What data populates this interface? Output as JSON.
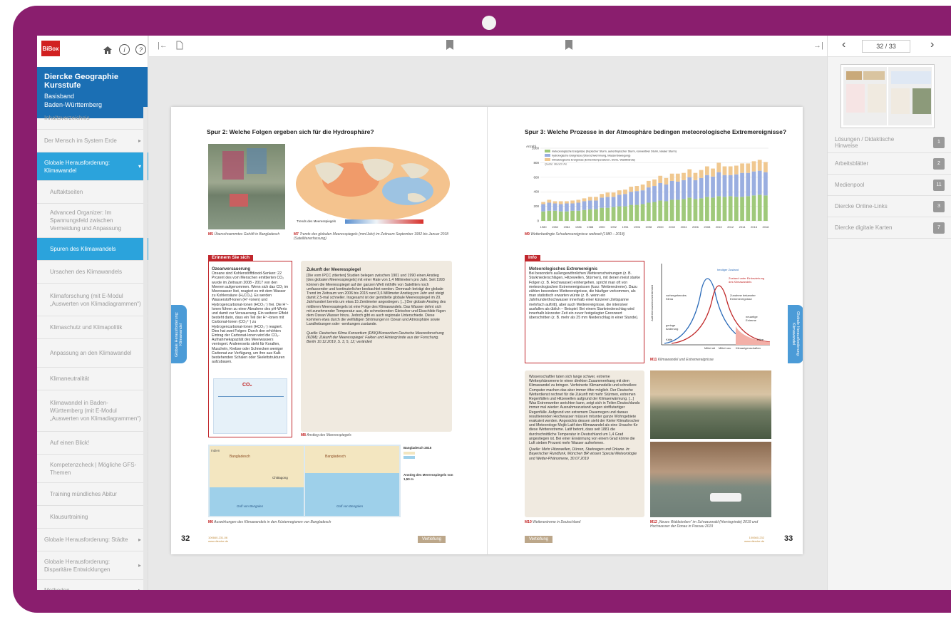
{
  "app": {
    "logo": "BiBox"
  },
  "book": {
    "title": "Diercke Geographie Kursstufe",
    "line2": "Basisband",
    "line3": "Baden-Württemberg"
  },
  "nav": [
    {
      "label": "Inhaltsverzeichnis",
      "level": 0,
      "h": 32
    },
    {
      "label": "Der Mensch im System Erde",
      "level": 0,
      "h": 32,
      "caret": "▸"
    },
    {
      "label": "Globale Herausforderung: Klimawandel",
      "level": 0,
      "h": 40,
      "caret": "▾",
      "active": true
    },
    {
      "label": "Auftaktseiten",
      "level": 1,
      "h": 32
    },
    {
      "label": "Advanced Organizer: Im Spannungsfeld zwischen Vermeidung und Anpassung",
      "level": 1,
      "h": 48
    },
    {
      "label": "Spuren des Klimawandels",
      "level": 1,
      "h": 32,
      "active": true
    },
    {
      "label": "Ursachen des Klimawandels",
      "level": 1,
      "h": 32
    },
    {
      "label": "Klimaforschung (mit E-Modul „Auswerten von Klimadiagrammen“)",
      "level": 1,
      "h": 46
    },
    {
      "label": "Klimaschutz und Klimapolitik",
      "level": 1,
      "h": 32
    },
    {
      "label": "Anpassung an den Klimawandel",
      "level": 1,
      "h": 40
    },
    {
      "label": "Klimaneutralität",
      "level": 1,
      "h": 32
    },
    {
      "label": "Klimawandel in Baden-Württemberg (mit E-Modul „Auswerten von Klimadiagrammen“)",
      "level": 1,
      "h": 58
    },
    {
      "label": "Auf einen Blick!",
      "level": 1,
      "h": 32
    },
    {
      "label": "Kompetenzcheck | Mögliche GFS-Themen",
      "level": 1,
      "h": 40
    },
    {
      "label": "Training mündliches Abitur",
      "level": 1,
      "h": 32
    },
    {
      "label": "Klausurtraining",
      "level": 1,
      "h": 32
    },
    {
      "label": "Globale Herausforderung: Städte",
      "level": 0,
      "h": 32,
      "caret": "▸"
    },
    {
      "label": "Globale Herausforderung: Disparitäre Entwicklungen",
      "level": 0,
      "h": 40,
      "caret": "▸"
    },
    {
      "label": "Methoden",
      "level": 0,
      "h": 30,
      "caret": "▸"
    }
  ],
  "pager": {
    "current": "32 / 33"
  },
  "resources": [
    {
      "label": "Lösungen / Didaktische Hinweise",
      "count": "1"
    },
    {
      "label": "Arbeitsblätter",
      "count": "2"
    },
    {
      "label": "Medienpool",
      "count": "11"
    },
    {
      "label": "Diercke Online-Links",
      "count": "3"
    },
    {
      "label": "Diercke digitale Karten",
      "count": "7"
    }
  ],
  "left_page": {
    "heading": "Spur 2: Welche Folgen ergeben sich für die Hydrosphäre?",
    "cap_m5": "Überschwemmtes Gehöft in Bangladesch",
    "cap_m7": "Trends des globalen Meeresspiegels (mm/Jahr) im Zeitraum September 1992 bis Januar 2018 (Satellitenerfassung)",
    "m5": "M5",
    "m7": "M7",
    "m8": "M8",
    "m6": "M6",
    "map_legend": "Trends des Meeresspiegels",
    "erinnern_label": "Erinnern Sie sich",
    "erinnern_title": "Ozeanversauerung",
    "erinnern_text": "Ozeane sind Kohlenstoffdioxid-Senken: 22 Prozent des vom Menschen emittierten CO₂ wurde im Zeitraum 2008 - 2017 von den Meeren aufgenommen. Wenn sich das CO₂ im Meerwasser löst, reagiert es mit dem Wasser zu Kohlensäure (H₂CO₃). Es werden Wasserstoff-Ionen (H⁺-Ionen) und Hydrogencarbonat-Ionen (HCO₃⁻) frei. Die H⁺-Ionen führen zu einer Abnahme des pH-Werts und damit zur Versauerung. Ein weiterer Effekt besteht darin, dass ein Teil der H⁺-Ionen mit Carbonat-Ionen (CO₃²⁻) zu Hydrogencarbonat-Ionen (HCO₃⁻) reagiert. Dies hat zwei Folgen: Durch den erhöhten Eintrag der Carbonat-Ionen wird die CO₂-Aufnahmekapazität des Meerwassers verringert. Andererseits steht für Korallen, Muscheln, Krebse oder Schnecken weniger Carbonat zur Verfügung, um ihre aus Kalk bestehenden Schalen oder Skelettstrukturen aufzubauen.",
    "zukunft_title": "Zukunft der Meeresspiegel",
    "zukunft_text": "[Die vom IPCC zitierten] Studien belegen zwischen 1901 und 1990 einen Anstieg [des globalen Meeresspiegels] mit einer Rate von 1,4 Millimetern pro Jahr. Seit 1993 können die Meeresspiegel auf der ganzen Welt mithilfe von Satelliten noch umfassender und kontinuierlicher beobachtet werden. Demnach beträgt der globale Trend im Zeitraum von 2006 bis 2015 rund 3,6 Millimeter Anstieg pro Jahr und steigt damit 2,5-mal schneller. Insgesamt ist der gemittelte globale Meeresspiegel im 20. Jahrhundert bereits um etwa 15 Zentimeter angestiegen. [...] Der globale Anstieg des mittleren Meeresspiegels ist eine Folge des Klimawandels. Das Wasser dehnt sich mit zunehmender Temperatur aus, die schmelzenden Gletscher und Eisschilde fügen dem Ozean Wasser hinzu. Jedoch gibt es auch regionale Unterschiede. Diese kommen etwa durch die vielfältigen Strömungen in Ozean und Atmosphäre sowie Landhebungen oder -senkungen zustande.",
    "zukunft_source": "Quelle: Deutsches Klima Konsortium (DKK)/Konsortium Deutsche Meeresforschung (KDM): Zukunft der Meeresspiegel: Fakten und Hintergründe aus der Forschung. Berlin 10.12.2019, S. 3, 5, 12; verändert",
    "cap_m8": "Anstieg des Meeresspiegels",
    "cap_m6": "Auswirkungen des Klimawandels in den Küstenregionen von Bangladesch",
    "map_labels": [
      "Indien",
      "Bangladesch",
      "Chittagong",
      "Golf von Bengalen"
    ],
    "bd_legend_1": "Bangladesch 2015",
    "bd_legend_2": "Anstieg des Meeresspiegels von 1,50 m",
    "page_number": "32",
    "code": "100660-231-06\nwww.diercke.de",
    "badge": "Vertiefung",
    "sidetab": "Globale Herausforderung: Klimawandel"
  },
  "right_page": {
    "heading": "Spur 3: Welche Prozesse in der Atmosphäre bedingen meteorologische Extremereignisse?",
    "m9": "M9",
    "m10": "M10",
    "m11": "M11",
    "m12": "M12",
    "cap_m9": "Wetterbedingte Schadensereignisse weltweit (1980 – 2018)",
    "info_label": "Info",
    "info_title": "Meteorologisches Extremereignis",
    "info_text": "Bei besonders außergewöhnlichen Wettererscheinungen (z. B. Starkniederschlägen, Hitzewellen, Stürmen), mit denen meist starke Folgen (z. B. Hochwasser) einhergehen, spricht man oft von meteorologischen Extremereignissen (kurz: Wetterextreme). Dazu zählen besondere Wetterereignisse, die häufiger vorkommen, als man statistisch erwarten würde (z. B. wenn ein Jahrhunderthochwasser innerhalb einer kürzeren Zeitspanne mehrfach auftritt), aber auch Wetterereignisse, die intensiver ausfallen als üblich – Beispiel: Bei einem Starkniederschlag wird innerhalb kürzester Zeit ein zuvor festgelegter Grenzwert überschritten (z. B. mehr als 25 mm Niederschlag in einer Stunde).",
    "cap_m11": "Klimawandel und Extremereignisse",
    "m11_labels": [
      "heutiger Zustand",
      "Zustand unter Einbeziehung des Klimawandels",
      "Zunahme bekannter Extremereignisse",
      "neuartige Extreme",
      "geringe Änderung",
      "Kälte",
      "Hitze",
      "Mittel alt",
      "Mittel neu",
      "Klimaeigenschaften",
      "Auftretenswahrscheinlichkeit",
      "vorhergehendes Klima"
    ],
    "m10_text": "Wissenschaftler taten sich lange schwer, extreme Wetterphänomene in einen direkten Zusammenhang mit dem Klimawandel zu bringen. Verfeinerte Klimamodelle und schnellere Computer machen das aber immer öfter möglich. Der Deutsche Wetterdienst rechnet für die Zukunft mit mehr Stürmen, extremen Regenfällen und Hitzewellen aufgrund der Klimaerwärmung. [...] Was Extremwetter anrichten kann, zeigt sich in Teilen Deutschlands immer mal wieder: Ausnahmezustand wegen sintflutartiger Regenfälle. Aufgrund von extremem Dauerregen und daraus resultierenden Hochwasser müssen mitunter ganze Wohngebiete evakuiert werden. Angesichts dessen sieht der Kieler Klimaforscher und Meteorologe Mojib Latif den Klimawandel als eine Ursache für diese Wetterextreme. Latif betont, dass seit 1881 die durchschnittliche Temperatur in Deutschland um 1,4 Grad angestiegen ist. Bei einer Erwärmung von einem Grad könne die Luft sieben Prozent mehr Wasser aufnehmen.",
    "m10_source": "Quelle: Mehr Hitzewellen, Dürren, Starkregen und Orkane. In: Bayerischer Rundfunk, München BR wissen Special Meteorologie und Wetter-Phänomene, 30.07.2019",
    "cap_m10": "Wetterextreme in Deutschland",
    "cap_m12": "„Neues Waldsterben“ im Schwarzwald (Hornisgrinde) 2019 und Hochwasser der Donau in Passau 2019",
    "page_number": "33",
    "code": "100660-232\nwww.diercke.de",
    "badge": "Vertiefung",
    "sidetab": "Globale Herausforderung: Klimawandel"
  },
  "chart_data": {
    "type": "bar",
    "title": "",
    "ylabel": "Anzahl",
    "ylim": [
      0,
      1000
    ],
    "yticks": [
      0,
      200,
      400,
      600,
      800,
      1000
    ],
    "xticks": [
      "1980",
      "1982",
      "1984",
      "1986",
      "1988",
      "1990",
      "1992",
      "1994",
      "1996",
      "1998",
      "2000",
      "2002",
      "2004",
      "2006",
      "2008",
      "2010",
      "2012",
      "2014",
      "2016",
      "2018"
    ],
    "categories": [
      "1980",
      "1981",
      "1982",
      "1983",
      "1984",
      "1985",
      "1986",
      "1987",
      "1988",
      "1989",
      "1990",
      "1991",
      "1992",
      "1993",
      "1994",
      "1995",
      "1996",
      "1997",
      "1998",
      "1999",
      "2000",
      "2001",
      "2002",
      "2003",
      "2004",
      "2005",
      "2006",
      "2007",
      "2008",
      "2009",
      "2010",
      "2011",
      "2012",
      "2013",
      "2014",
      "2015",
      "2016",
      "2017",
      "2018"
    ],
    "stacked": true,
    "series": [
      {
        "name": "meteorologische Ereignisse (tropischer Sturm, außertropischer Sturm, konvektiver Sturm, lokaler Sturm)",
        "color": "#9fc97a",
        "values": [
          130,
          140,
          140,
          130,
          130,
          140,
          140,
          150,
          160,
          160,
          180,
          180,
          190,
          200,
          200,
          220,
          220,
          230,
          250,
          260,
          280,
          270,
          290,
          290,
          300,
          320,
          300,
          310,
          330,
          320,
          340,
          330,
          340,
          330,
          330,
          340,
          350,
          360,
          350
        ]
      },
      {
        "name": "hydrologische Ereignisse (Überschwemmung, Massenbewegung)",
        "color": "#9aaee0",
        "values": [
          100,
          110,
          100,
          100,
          110,
          100,
          110,
          120,
          120,
          120,
          140,
          150,
          140,
          160,
          170,
          180,
          190,
          190,
          210,
          220,
          240,
          230,
          260,
          250,
          260,
          280,
          260,
          280,
          300,
          290,
          330,
          300,
          290,
          310,
          330,
          320,
          330,
          330,
          320
        ]
      },
      {
        "name": "klimatologische Ereignisse (Extremtemperaturen, Dürre, Waldbrände)",
        "color": "#f0c890",
        "values": [
          30,
          40,
          30,
          40,
          30,
          40,
          40,
          40,
          50,
          50,
          50,
          60,
          60,
          60,
          60,
          70,
          70,
          80,
          90,
          90,
          100,
          90,
          100,
          110,
          100,
          110,
          100,
          110,
          120,
          110,
          130,
          120,
          120,
          120,
          130,
          130,
          140,
          150,
          140
        ]
      }
    ],
    "source": "Quelle: Munich Re"
  }
}
